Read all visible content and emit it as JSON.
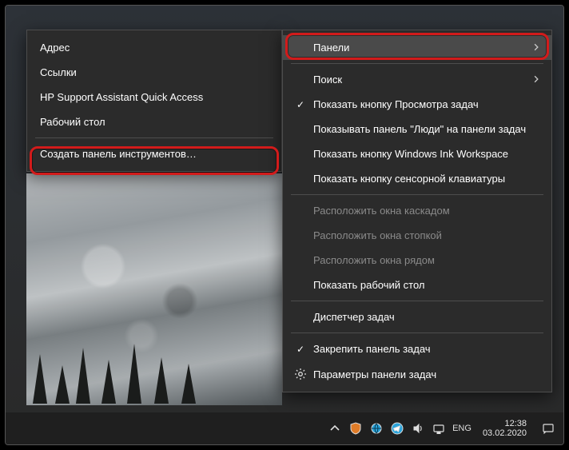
{
  "submenu": {
    "address": "Адрес",
    "links": "Ссылки",
    "hp": "HP Support Assistant Quick Access",
    "desktop": "Рабочий стол",
    "newToolbar": "Создать панель инструментов…"
  },
  "mainmenu": {
    "panels": "Панели",
    "search": "Поиск",
    "showTaskView": "Показать кнопку Просмотра задач",
    "showPeople": "Показывать панель \"Люди\" на панели задач",
    "showInk": "Показать кнопку Windows Ink Workspace",
    "showTouchKb": "Показать кнопку сенсорной клавиатуры",
    "cascade": "Расположить окна каскадом",
    "stack": "Расположить окна стопкой",
    "sideBySide": "Расположить окна рядом",
    "showDesktop": "Показать рабочий стол",
    "taskMgr": "Диспетчер задач",
    "lockTaskbar": "Закрепить панель задач",
    "taskbarSettings": "Параметры панели задач"
  },
  "tray": {
    "lang": "ENG",
    "time": "12:38",
    "date": "03.02.2020"
  }
}
